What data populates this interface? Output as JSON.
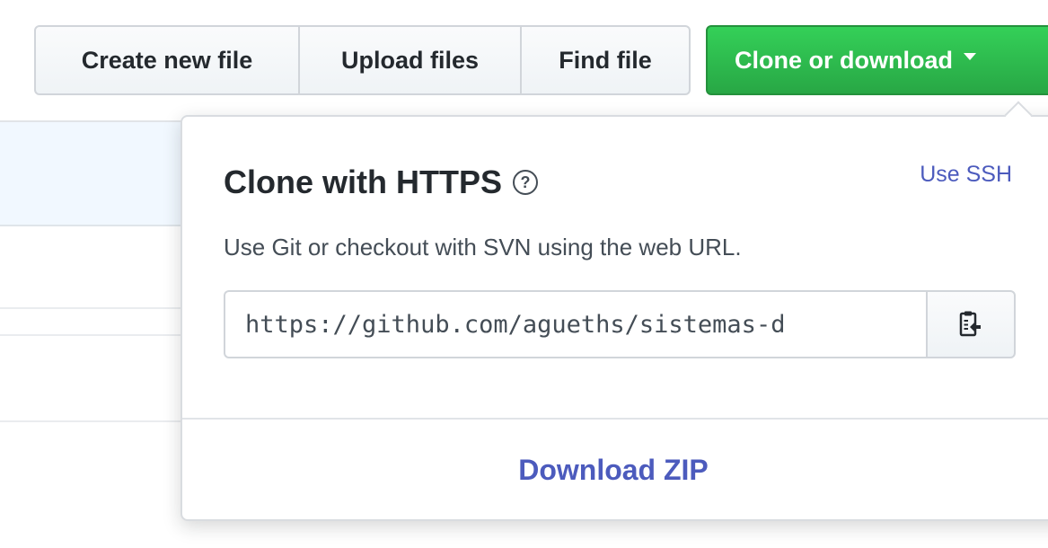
{
  "toolbar": {
    "create_new_file": "Create new file",
    "upload_files": "Upload files",
    "find_file": "Find file",
    "clone_or_download": "Clone or download"
  },
  "clone_panel": {
    "title": "Clone with HTTPS",
    "help_icon_glyph": "?",
    "use_ssh": "Use SSH",
    "description": "Use Git or checkout with SVN using the web URL.",
    "url": "https://github.com/agueths/sistemas-d",
    "copy_icon": "clipboard-icon",
    "download_zip": "Download ZIP"
  },
  "colors": {
    "clone_button": "#28a745",
    "link": "#4c5bbd",
    "file_list_header": "#f1f8ff"
  }
}
